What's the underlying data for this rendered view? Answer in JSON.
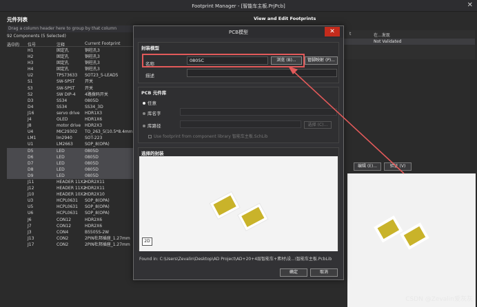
{
  "window": {
    "title": "Footprint Manager - [智能车主板.PrjPcb]",
    "close_glyph": "✕"
  },
  "left_panel": {
    "header": "元件列表",
    "group_hint": "Drag a column header here to group by that column",
    "count": "92 Components (5 Selected)",
    "columns": [
      "选中的",
      "位号",
      "注释",
      "Current Footprint"
    ],
    "rows": [
      {
        "ref": "H1",
        "comment": "固定孔",
        "fp": "铜柱孔3",
        "sel": false
      },
      {
        "ref": "H2",
        "comment": "固定孔",
        "fp": "铜柱孔3",
        "sel": false
      },
      {
        "ref": "H3",
        "comment": "固定孔",
        "fp": "铜柱孔3",
        "sel": false
      },
      {
        "ref": "H4",
        "comment": "固定孔",
        "fp": "铜柱孔3",
        "sel": false
      },
      {
        "ref": "U2",
        "comment": "TPS73633",
        "fp": "SOT23_5-LEAD5",
        "sel": false
      },
      {
        "ref": "S1",
        "comment": "SW-SPST",
        "fp": "开关",
        "sel": false
      },
      {
        "ref": "S3",
        "comment": "SW-SPST",
        "fp": "开关",
        "sel": false
      },
      {
        "ref": "S2",
        "comment": "SW DIP-4",
        "fp": "4路拨码开关",
        "sel": false
      },
      {
        "ref": "D3",
        "comment": "SS34",
        "fp": "0805D",
        "sel": false
      },
      {
        "ref": "D4",
        "comment": "SS34",
        "fp": "SS34_3D",
        "sel": false
      },
      {
        "ref": "J16",
        "comment": "servo drive",
        "fp": "HDR1X3",
        "sel": false
      },
      {
        "ref": "J4",
        "comment": "OLED",
        "fp": "HDR1X6",
        "sel": false
      },
      {
        "ref": "J8",
        "comment": "motor drive",
        "fp": "HDR2X3",
        "sel": false
      },
      {
        "ref": "U4",
        "comment": "MIC29302",
        "fp": "TO_263_5(10.5*8.4mm",
        "sel": false
      },
      {
        "ref": "LM1",
        "comment": "lm2940",
        "fp": "SOT-223",
        "sel": false
      },
      {
        "ref": "U1",
        "comment": "LM2663",
        "fp": "SOP_8(OPA)",
        "sel": false
      },
      {
        "ref": "D5",
        "comment": "LED",
        "fp": "0805D",
        "sel": true
      },
      {
        "ref": "D6",
        "comment": "LED",
        "fp": "0805D",
        "sel": true
      },
      {
        "ref": "D7",
        "comment": "LED",
        "fp": "0805D",
        "sel": true
      },
      {
        "ref": "D8",
        "comment": "LED",
        "fp": "0805D",
        "sel": true
      },
      {
        "ref": "D9",
        "comment": "LED",
        "fp": "0805D",
        "sel": true
      },
      {
        "ref": "J11",
        "comment": "HEADER 11X2",
        "fp": "HDR2X11",
        "sel": false
      },
      {
        "ref": "J12",
        "comment": "HEADER 11X2",
        "fp": "HDR2X11",
        "sel": false
      },
      {
        "ref": "J10",
        "comment": "HEADER 10X2",
        "fp": "HDR2X10",
        "sel": false
      },
      {
        "ref": "U3",
        "comment": "HCPL0631",
        "fp": "SOP_8(OPA)",
        "sel": false
      },
      {
        "ref": "U5",
        "comment": "HCPL0631",
        "fp": "SOP_8(OPA)",
        "sel": false
      },
      {
        "ref": "U6",
        "comment": "HCPL0631",
        "fp": "SOP_8(OPA)",
        "sel": false
      },
      {
        "ref": "J6",
        "comment": "CON12",
        "fp": "HDR2X6",
        "sel": false
      },
      {
        "ref": "J7",
        "comment": "CON12",
        "fp": "HDR2X6",
        "sel": false
      },
      {
        "ref": "J3",
        "comment": "CON4",
        "fp": "B5505S-2W",
        "sel": false
      },
      {
        "ref": "J13",
        "comment": "CON2",
        "fp": "2PIN杜邦插座_1.27mm",
        "sel": false
      },
      {
        "ref": "J17",
        "comment": "CON2",
        "fp": "2PIN杜邦插座_1.27mm",
        "sel": false
      }
    ]
  },
  "right_panel": {
    "header": "View and Edit Footprints",
    "col_partial": "t",
    "col_found": "在...发现",
    "found_value": "Not Validated",
    "edit_btn": "编辑 (E)...",
    "verify_btn": "验证 (V)"
  },
  "dialog": {
    "title": "PCB模型",
    "close_glyph": "✕",
    "section_model": "封装模型",
    "name_label": "名称",
    "name_value": "0805C",
    "browse_btn": "浏览 (B)...",
    "pinmap_btn": "管脚映射 (P)...",
    "desc_label": "描述",
    "section_lib": "PCB 元件库",
    "opt_any": "任意",
    "opt_libname": "库名字",
    "opt_libpath": "库路径",
    "choose_btn": "选择 (C)...",
    "use_fp_check": "Use footprint from component library 智能车主板.SchLib",
    "section_selected": "选择的封装",
    "tag_2d": "2D",
    "found_in": "Found in:   C:\\Users\\Zevalin\\Desktop\\AD  Project\\AD+20+4层智能车+素材\\设...\\智能车主板.PcbLib",
    "ok_btn": "确定",
    "cancel_btn": "取消"
  },
  "watermark": "CSDN @Zevalin爱灰灰",
  "colors": {
    "highlight": "#e35a5a",
    "pad": "#c9b32a",
    "close_bg": "#c42b1c"
  }
}
